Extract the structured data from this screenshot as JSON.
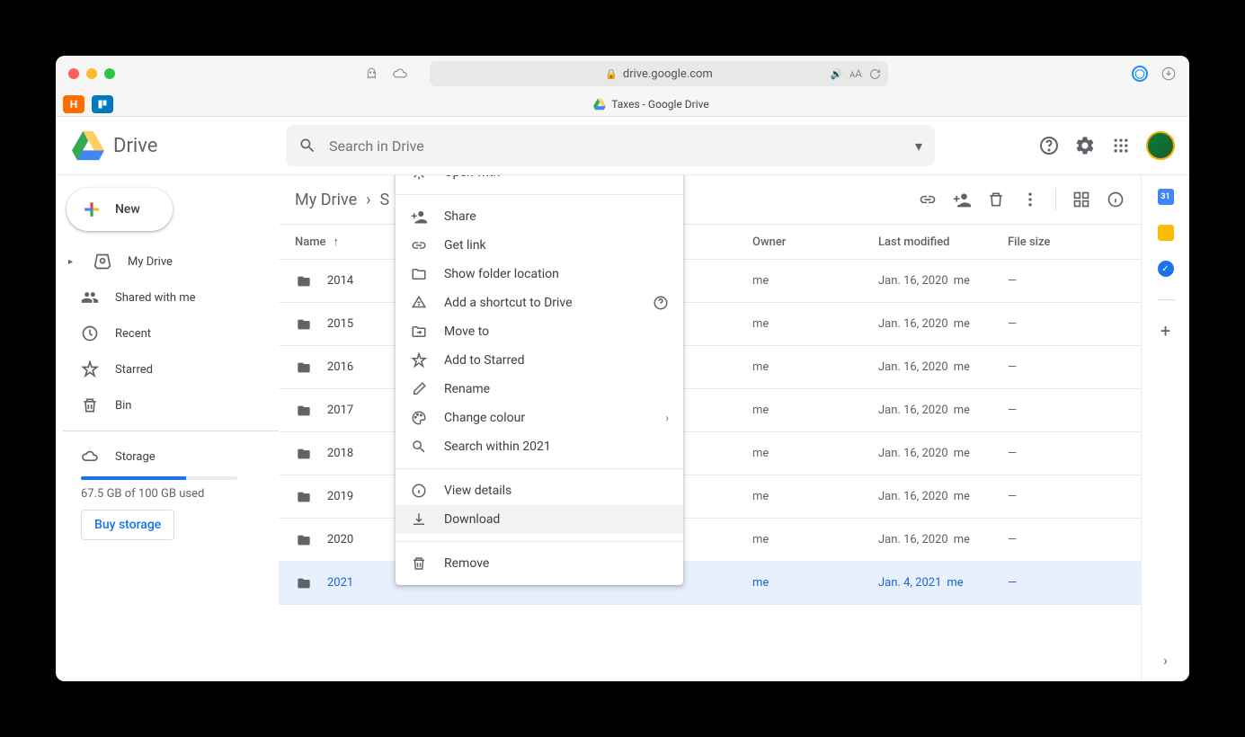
{
  "browser": {
    "url": "drive.google.com",
    "tab_title": "Taxes - Google Drive"
  },
  "app": {
    "name": "Drive",
    "search_placeholder": "Search in Drive"
  },
  "sidebar": {
    "new_label": "New",
    "items": [
      {
        "label": "My Drive"
      },
      {
        "label": "Shared with me"
      },
      {
        "label": "Recent"
      },
      {
        "label": "Starred"
      },
      {
        "label": "Bin"
      }
    ],
    "storage_label": "Storage",
    "storage_text": "67.5 GB of 100 GB used",
    "buy_label": "Buy storage"
  },
  "breadcrumb": {
    "root": "My Drive",
    "current_partial": "S"
  },
  "columns": {
    "name": "Name",
    "owner": "Owner",
    "modified": "Last modified",
    "size": "File size"
  },
  "rows": [
    {
      "name": "2014",
      "owner": "me",
      "modified": "Jan. 16, 2020",
      "modified_by": "me",
      "size": "—"
    },
    {
      "name": "2015",
      "owner": "me",
      "modified": "Jan. 16, 2020",
      "modified_by": "me",
      "size": "—"
    },
    {
      "name": "2016",
      "owner": "me",
      "modified": "Jan. 16, 2020",
      "modified_by": "me",
      "size": "—"
    },
    {
      "name": "2017",
      "owner": "me",
      "modified": "Jan. 16, 2020",
      "modified_by": "me",
      "size": "—"
    },
    {
      "name": "2018",
      "owner": "me",
      "modified": "Jan. 16, 2020",
      "modified_by": "me",
      "size": "—"
    },
    {
      "name": "2019",
      "owner": "me",
      "modified": "Jan. 16, 2020",
      "modified_by": "me",
      "size": "—"
    },
    {
      "name": "2020",
      "owner": "me",
      "modified": "Jan. 16, 2020",
      "modified_by": "me",
      "size": "—"
    },
    {
      "name": "2021",
      "owner": "me",
      "modified": "Jan. 4, 2021",
      "modified_by": "me",
      "size": "—",
      "selected": true
    }
  ],
  "menu": {
    "open_with": "Open with",
    "share": "Share",
    "get_link": "Get link",
    "show_folder": "Show folder location",
    "add_shortcut": "Add a shortcut to Drive",
    "move_to": "Move to",
    "add_starred": "Add to Starred",
    "rename": "Rename",
    "change_colour": "Change colour",
    "search_within": "Search within 2021",
    "view_details": "View details",
    "download": "Download",
    "remove": "Remove"
  },
  "side_panel": {
    "cal_day": "31"
  }
}
